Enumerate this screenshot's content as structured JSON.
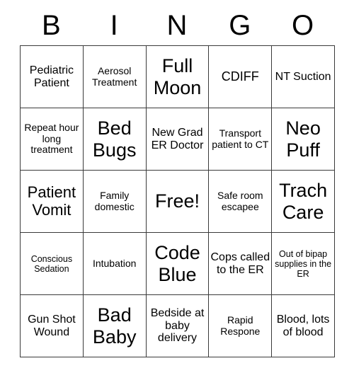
{
  "card": {
    "title_letters": [
      "B",
      "I",
      "N",
      "G",
      "O"
    ],
    "free_space_label": "Free!",
    "rows": [
      [
        {
          "text": "Pediatric Patient",
          "size": "md"
        },
        {
          "text": "Aerosol Treatment",
          "size": "sm"
        },
        {
          "text": "Full Moon",
          "size": "xxl"
        },
        {
          "text": "CDIFF",
          "size": "lg"
        },
        {
          "text": "NT Suction",
          "size": "md"
        }
      ],
      [
        {
          "text": "Repeat hour long treatment",
          "size": "sm"
        },
        {
          "text": "Bed Bugs",
          "size": "xxl"
        },
        {
          "text": "New Grad ER Doctor",
          "size": "md"
        },
        {
          "text": "Transport patient to CT",
          "size": "sm"
        },
        {
          "text": "Neo Puff",
          "size": "xxl"
        }
      ],
      [
        {
          "text": "Patient Vomit",
          "size": "xl"
        },
        {
          "text": "Family domestic",
          "size": "sm"
        },
        {
          "text": "Free!",
          "size": "free"
        },
        {
          "text": "Safe room escapee",
          "size": "sm"
        },
        {
          "text": "Trach Care",
          "size": "xxl"
        }
      ],
      [
        {
          "text": "Conscious Sedation",
          "size": "xs"
        },
        {
          "text": "Intubation",
          "size": "sm"
        },
        {
          "text": "Code Blue",
          "size": "xxl"
        },
        {
          "text": "Cops called to the ER",
          "size": "md"
        },
        {
          "text": "Out of bipap supplies in the ER",
          "size": "xs"
        }
      ],
      [
        {
          "text": "Gun Shot Wound",
          "size": "md"
        },
        {
          "text": "Bad Baby",
          "size": "xxl"
        },
        {
          "text": "Bedside at baby delivery",
          "size": "md"
        },
        {
          "text": "Rapid Respone",
          "size": "sm"
        },
        {
          "text": "Blood, lots of blood",
          "size": "md"
        }
      ]
    ]
  },
  "colors": {
    "border": "#3a3a3a",
    "text": "#000000",
    "background": "#ffffff"
  }
}
